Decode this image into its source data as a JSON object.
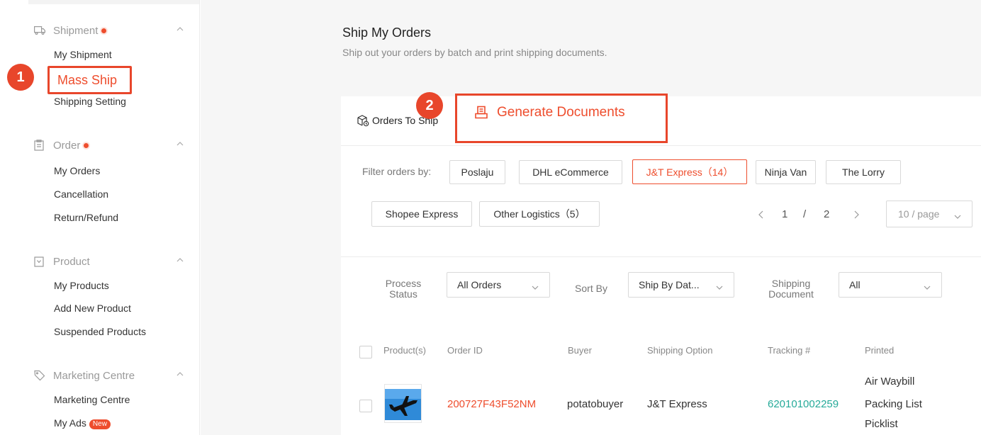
{
  "sidebar": {
    "sections": [
      {
        "title": "Shipment",
        "icon": "truck-icon",
        "has_dot": true,
        "items": [
          "My Shipment",
          "Mass Ship",
          "Shipping Setting"
        ]
      },
      {
        "title": "Order",
        "icon": "clipboard-icon",
        "has_dot": true,
        "items": [
          "My Orders",
          "Cancellation",
          "Return/Refund"
        ]
      },
      {
        "title": "Product",
        "icon": "bag-icon",
        "has_dot": false,
        "items": [
          "My Products",
          "Add New Product",
          "Suspended Products"
        ]
      },
      {
        "title": "Marketing Centre",
        "icon": "tag-icon",
        "has_dot": false,
        "items": [
          "Marketing Centre",
          "My Ads"
        ]
      }
    ],
    "active_item": "Mass Ship",
    "new_badge": "New"
  },
  "annotations": {
    "step1": "1",
    "step2": "2"
  },
  "main": {
    "title": "Ship My Orders",
    "subtitle": "Ship out your orders by batch and print shipping documents.",
    "tab_label": "Orders To Ship",
    "generate_button": "Generate Documents",
    "filter_label": "Filter orders by:",
    "filters": [
      "Poslaju",
      "DHL eCommerce",
      "J&T Express（14）",
      "Ninja Van",
      "The Lorry",
      "Shopee Express",
      "Other Logistics（5）"
    ],
    "selected_filter": "J&T Express（14）",
    "pagination": {
      "current": "1",
      "separator": "/",
      "total": "2",
      "page_size": "10 / page"
    },
    "process_status_label": "Process Status",
    "process_status_value": "All Orders",
    "sort_by_label": "Sort By",
    "sort_by_value": "Ship By Dat...",
    "shipping_document_label": "Shipping Document",
    "shipping_document_value": "All",
    "table": {
      "headers": [
        "Product(s)",
        "Order ID",
        "Buyer",
        "Shipping Option",
        "Tracking #",
        "Printed"
      ],
      "rows": [
        {
          "order_id": "200727F43F52NM",
          "buyer": "potatobuyer",
          "shipping_option": "J&T Express",
          "tracking": "620101002259",
          "printed": [
            "Air Waybill",
            "Packing List",
            "Picklist"
          ]
        }
      ]
    }
  },
  "colors": {
    "accent": "#ee4d2d",
    "highlight_box": "#e8462b",
    "tracking": "#26aa99"
  }
}
